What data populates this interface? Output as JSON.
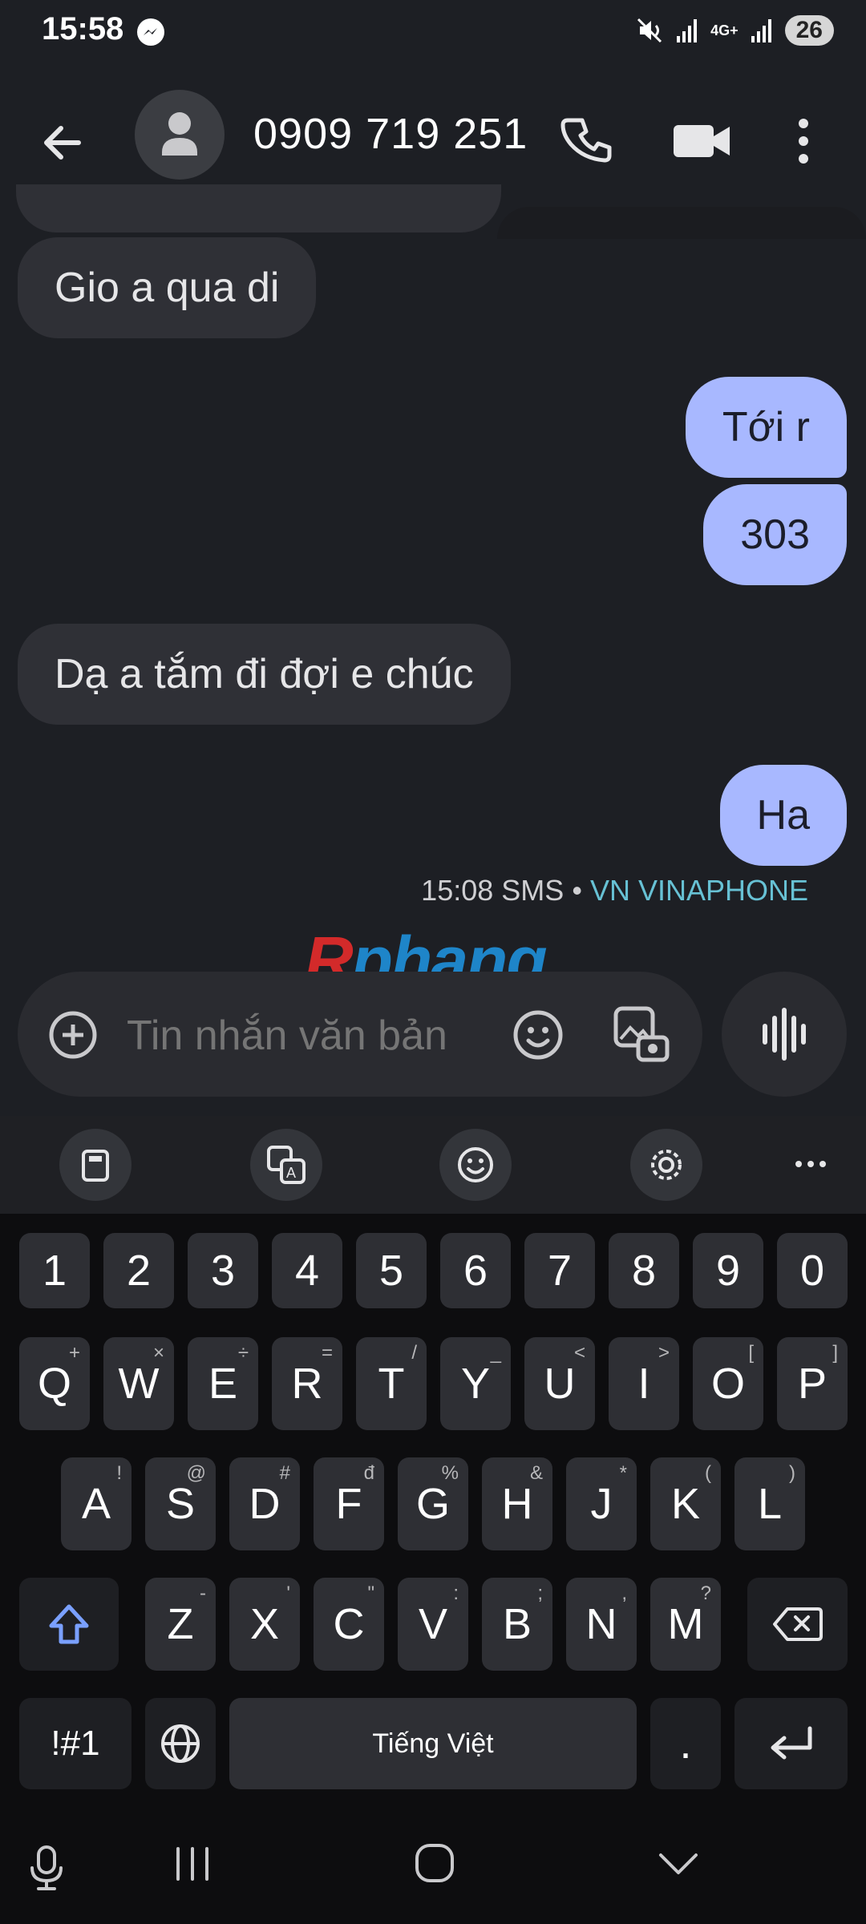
{
  "status": {
    "time": "15:58",
    "battery": "26",
    "network": "4G+"
  },
  "contact": {
    "name": "0909 719 251"
  },
  "messages": [
    {
      "dir": "in",
      "text": "Gio a qua di"
    },
    {
      "dir": "out",
      "text": "Tới r"
    },
    {
      "dir": "out",
      "text": "303"
    },
    {
      "dir": "in",
      "text": "Dạ a tắm đi đợi e chúc"
    },
    {
      "dir": "out",
      "text": "Ha"
    }
  ],
  "meta": {
    "time": "15:08",
    "type": "SMS",
    "separator": "•",
    "sim": "VN VINAPHONE"
  },
  "watermark": {
    "first": "R",
    "rest": "phang"
  },
  "compose": {
    "placeholder": "Tin nhắn văn bản"
  },
  "keyboard": {
    "numbers": [
      "1",
      "2",
      "3",
      "4",
      "5",
      "6",
      "7",
      "8",
      "9",
      "0"
    ],
    "row1": [
      {
        "k": "Q",
        "h": "+"
      },
      {
        "k": "W",
        "h": "×"
      },
      {
        "k": "E",
        "h": "÷"
      },
      {
        "k": "R",
        "h": "="
      },
      {
        "k": "T",
        "h": "/"
      },
      {
        "k": "Y",
        "h": "_"
      },
      {
        "k": "U",
        "h": "<"
      },
      {
        "k": "I",
        "h": ">"
      },
      {
        "k": "O",
        "h": "["
      },
      {
        "k": "P",
        "h": "]"
      }
    ],
    "row2": [
      {
        "k": "A",
        "h": "!"
      },
      {
        "k": "S",
        "h": "@"
      },
      {
        "k": "D",
        "h": "#"
      },
      {
        "k": "F",
        "h": "đ"
      },
      {
        "k": "G",
        "h": "%"
      },
      {
        "k": "H",
        "h": "&"
      },
      {
        "k": "J",
        "h": "*"
      },
      {
        "k": "K",
        "h": "("
      },
      {
        "k": "L",
        "h": ")"
      }
    ],
    "row3": [
      {
        "k": "Z",
        "h": "-"
      },
      {
        "k": "X",
        "h": "'"
      },
      {
        "k": "C",
        "h": "\""
      },
      {
        "k": "V",
        "h": ":"
      },
      {
        "k": "B",
        "h": ";"
      },
      {
        "k": "N",
        "h": ","
      },
      {
        "k": "M",
        "h": "?"
      }
    ],
    "symbols_label": "!#1",
    "space_label": "Tiếng Việt",
    "period": "."
  }
}
